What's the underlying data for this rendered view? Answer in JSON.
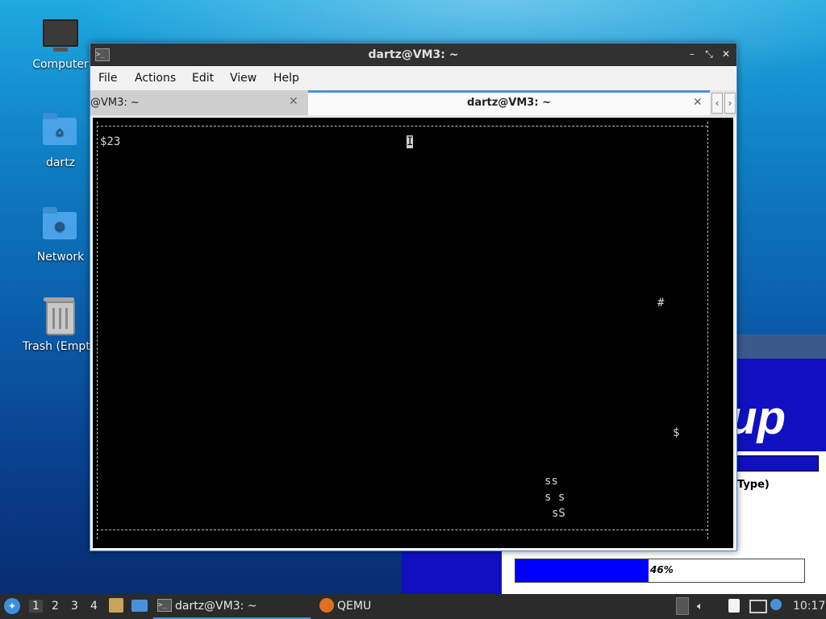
{
  "desktop": {
    "icons": [
      {
        "label": "Computer",
        "icon": "computer-icon"
      },
      {
        "label": "dartz",
        "icon": "home-folder-icon"
      },
      {
        "label": "Network",
        "icon": "network-folder-icon"
      },
      {
        "label": "Trash (Empt",
        "icon": "trash-icon"
      }
    ]
  },
  "background_window": {
    "banner_text": "up",
    "field_text": "Type)",
    "progress_percent": 46,
    "progress_label": "46%"
  },
  "terminal": {
    "title": "dartz@VM3: ~",
    "menu": [
      "File",
      "Actions",
      "Edit",
      "View",
      "Help"
    ],
    "tabs": [
      {
        "label": "@VM3: ~",
        "active": false
      },
      {
        "label": "dartz@VM3: ~",
        "active": true
      }
    ],
    "screen": {
      "score": "$23",
      "cursor_char": "I",
      "hash": "#",
      "dollar": "$",
      "snake_row1": "ss",
      "snake_row2": "s s",
      "snake_row3": "sS"
    }
  },
  "taskbar": {
    "workspaces": [
      "1",
      "2",
      "3",
      "4"
    ],
    "active_workspace": "1",
    "apps": [
      {
        "label": "dartz@VM3: ~",
        "icon": "terminal-icon"
      },
      {
        "label": "QEMU",
        "icon": "qemu-icon"
      }
    ],
    "clock": "10:17"
  }
}
